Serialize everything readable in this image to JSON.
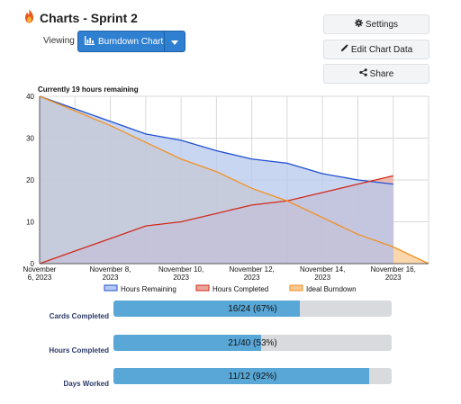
{
  "header": {
    "title": "Charts - Sprint 2",
    "viewing_label": "Viewing",
    "view_selected": "Burndown Chart"
  },
  "actions": {
    "settings": "Settings",
    "edit_chart_data": "Edit Chart Data",
    "share": "Share"
  },
  "chart": {
    "heading": "Currently 19 hours remaining"
  },
  "chart_data": {
    "type": "area",
    "title": "Currently 19 hours remaining",
    "ylim": [
      0,
      40
    ],
    "yticks": [
      0,
      10,
      20,
      30,
      40
    ],
    "xlim": [
      "2023-11-06",
      "2023-11-17"
    ],
    "xtick_labels": [
      {
        "date": "2023-11-06",
        "line1": "November",
        "line2": "6, 2023"
      },
      {
        "date": "2023-11-08",
        "line1": "November 8,",
        "line2": "2023"
      },
      {
        "date": "2023-11-10",
        "line1": "November 10,",
        "line2": "2023"
      },
      {
        "date": "2023-11-12",
        "line1": "November 12,",
        "line2": "2023"
      },
      {
        "date": "2023-11-14",
        "line1": "November 14,",
        "line2": "2023"
      },
      {
        "date": "2023-11-16",
        "line1": "November 16,",
        "line2": "2023"
      }
    ],
    "grid": true,
    "legend_position": "bottom",
    "series": [
      {
        "name": "Hours Remaining",
        "color": "#1f4fd1",
        "fill": "#b6c8ee",
        "points": [
          [
            "2023-11-06",
            40
          ],
          [
            "2023-11-07",
            37
          ],
          [
            "2023-11-08",
            34
          ],
          [
            "2023-11-09",
            31
          ],
          [
            "2023-11-10",
            29.5
          ],
          [
            "2023-11-11",
            27
          ],
          [
            "2023-11-12",
            25
          ],
          [
            "2023-11-13",
            24
          ],
          [
            "2023-11-14",
            21.5
          ],
          [
            "2023-11-15",
            20
          ],
          [
            "2023-11-16",
            19
          ]
        ]
      },
      {
        "name": "Hours Completed",
        "color": "#d12a1a",
        "fill": "#e9a79a",
        "points": [
          [
            "2023-11-06",
            0
          ],
          [
            "2023-11-07",
            3
          ],
          [
            "2023-11-08",
            6
          ],
          [
            "2023-11-09",
            9
          ],
          [
            "2023-11-10",
            10
          ],
          [
            "2023-11-11",
            12
          ],
          [
            "2023-11-12",
            14
          ],
          [
            "2023-11-13",
            15
          ],
          [
            "2023-11-14",
            17
          ],
          [
            "2023-11-15",
            19
          ],
          [
            "2023-11-16",
            21
          ]
        ]
      },
      {
        "name": "Ideal Burndown",
        "color": "#f3911f",
        "fill": "#f7c890",
        "points": [
          [
            "2023-11-06",
            40
          ],
          [
            "2023-11-07",
            36.5
          ],
          [
            "2023-11-08",
            33
          ],
          [
            "2023-11-09",
            29
          ],
          [
            "2023-11-10",
            25
          ],
          [
            "2023-11-11",
            22
          ],
          [
            "2023-11-12",
            18
          ],
          [
            "2023-11-13",
            15
          ],
          [
            "2023-11-14",
            11
          ],
          [
            "2023-11-15",
            7
          ],
          [
            "2023-11-16",
            4
          ],
          [
            "2023-11-17",
            0
          ]
        ]
      }
    ]
  },
  "stats": [
    {
      "label": "Cards Completed",
      "text": "16/24 (67%)",
      "fraction": 0.67
    },
    {
      "label": "Hours Completed",
      "text": "21/40 (53%)",
      "fraction": 0.53
    },
    {
      "label": "Days Worked",
      "text": "11/12 (92%)",
      "fraction": 0.92
    }
  ],
  "colors": {
    "accent": "#2f80d1",
    "bar_fill": "#58a7d6",
    "bar_track": "#d8dade",
    "stat_label": "#2b3a67"
  }
}
